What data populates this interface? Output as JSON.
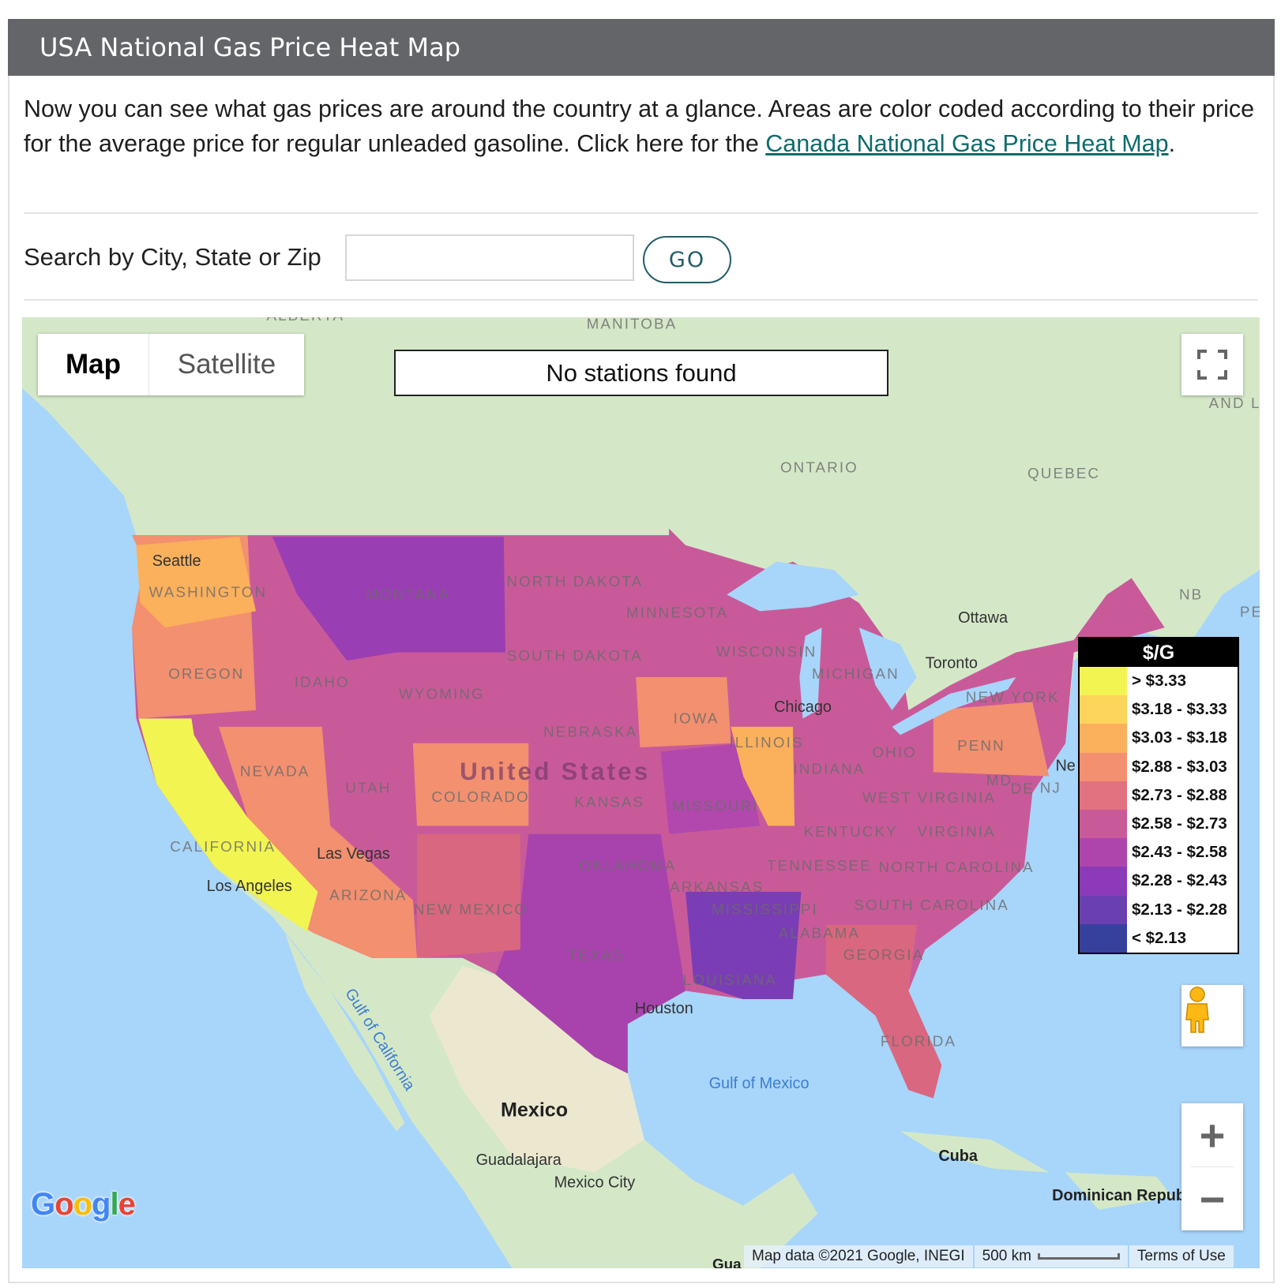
{
  "header": {
    "title": "USA National Gas Price Heat Map"
  },
  "intro": {
    "text": "Now you can see what gas prices are around the country at a glance. Areas are color coded according to their price for the average price for regular unleaded gasoline. Click here for the ",
    "link_text": "Canada National Gas Price Heat Map",
    "trailing": "."
  },
  "search": {
    "label": "Search by City, State or Zip",
    "value": "",
    "placeholder": "",
    "button": "GO"
  },
  "map": {
    "type_controls": {
      "map": "Map",
      "satellite": "Satellite",
      "selected": "Map"
    },
    "status": "No stations found",
    "legend": {
      "title": "$/G",
      "items": [
        {
          "label": "> $3.33",
          "color": "#f2f451"
        },
        {
          "label": "$3.18 - $3.33",
          "color": "#fdd55a"
        },
        {
          "label": "$3.03 - $3.18",
          "color": "#fbb05c"
        },
        {
          "label": "$2.88 - $3.03",
          "color": "#f29070"
        },
        {
          "label": "$2.73 - $2.88",
          "color": "#e2727f"
        },
        {
          "label": "$2.58 - $2.73",
          "color": "#c95a99"
        },
        {
          "label": "$2.43 - $2.58",
          "color": "#ad45ad"
        },
        {
          "label": "$2.28 - $2.43",
          "color": "#8c3ab8"
        },
        {
          "label": "$2.13 - $2.28",
          "color": "#6a40b0"
        },
        {
          "label": "< $2.13",
          "color": "#36419d"
        }
      ]
    },
    "labels": [
      "ALBERTA",
      "MANITOBA",
      "ONTARIO",
      "QUEBEC",
      "NB",
      "PE",
      "AND L",
      "Seattle",
      "WASHINGTON",
      "MONTANA",
      "NORTH DAKOTA",
      "MINNESOTA",
      "SOUTH DAKOTA",
      "OREGON",
      "IDAHO",
      "WYOMING",
      "WISCONSIN",
      "MICHIGAN",
      "Ottawa",
      "Toronto",
      "NEW YORK",
      "Chicago",
      "IOWA",
      "NEBRASKA",
      "ILLINOIS",
      "OHIO",
      "PENN",
      "INDIANA",
      "NEVADA",
      "UTAH",
      "United States",
      "COLORADO",
      "KANSAS",
      "MISSOURI",
      "WEST VIRGINIA",
      "VIRGINIA",
      "MD",
      "DE",
      "NJ",
      "KENTUCKY",
      "CALIFORNIA",
      "Las Vegas",
      "TENNESSEE",
      "NORTH CAROLINA",
      "OKLAHOMA",
      "Los Angeles",
      "ARIZONA",
      "NEW MEXICO",
      "ARKANSAS",
      "MISSISSIPPI",
      "SOUTH CAROLINA",
      "ALABAMA",
      "GEORGIA",
      "TEXAS",
      "LOUISIANA",
      "Houston",
      "FLORIDA",
      "Gulf of California",
      "Gulf of Mexico",
      "Mexico",
      "Guadalajara",
      "Mexico City",
      "Cuba",
      "Dominican Republic",
      "Ne",
      "Gua"
    ],
    "attribution": "Map data ©2021 Google, INEGI",
    "scale": "500 km",
    "terms": "Terms of Use",
    "logo": "Google",
    "colors": {
      "water": "#a8d5fa",
      "land": "#d4e8c8",
      "default_region": "#c95a99"
    }
  }
}
